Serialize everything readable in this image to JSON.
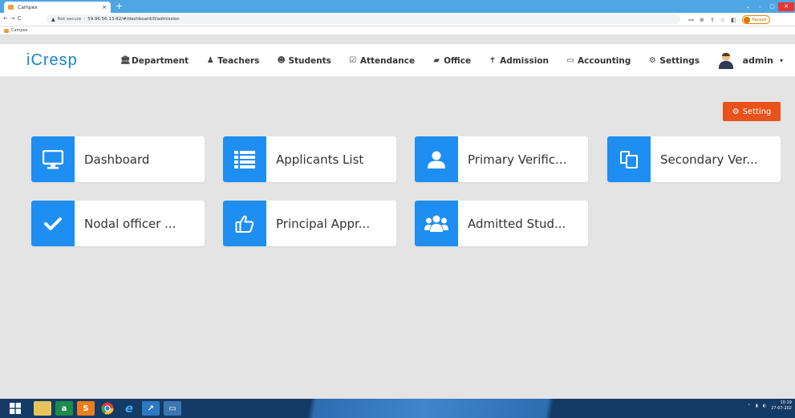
{
  "browser": {
    "tab_title": "Campex",
    "tab_close": "×",
    "new_tab": "+",
    "security": "Not secure",
    "url": "59.96.56.13:82/#/dashboard/0/admission",
    "bookmark": "Campex",
    "profile_status": "Paused",
    "window_controls": [
      "⌄",
      "–",
      "▢",
      "✕"
    ]
  },
  "app": {
    "logo": "iCresp",
    "nav": [
      {
        "label": "Department",
        "icon": "bank-icon"
      },
      {
        "label": "Teachers",
        "icon": "user-icon"
      },
      {
        "label": "Students",
        "icon": "users-icon"
      },
      {
        "label": "Attendance",
        "icon": "check-square-icon"
      },
      {
        "label": "Office",
        "icon": "book-icon"
      },
      {
        "label": "Admission",
        "icon": "graduate-icon"
      },
      {
        "label": "Accounting",
        "icon": "credit-card-icon"
      },
      {
        "label": "Settings",
        "icon": "gear-icon"
      }
    ],
    "user": "admin"
  },
  "content": {
    "setting_button": "Setting",
    "cards": [
      {
        "label": "Dashboard",
        "icon": "monitor-icon"
      },
      {
        "label": "Applicants List",
        "icon": "list-icon"
      },
      {
        "label": "Primary Verific...",
        "icon": "user-icon"
      },
      {
        "label": "Secondary Ver...",
        "icon": "copy-icon"
      },
      {
        "label": "Nodal officer ...",
        "icon": "check-icon"
      },
      {
        "label": "Principal Appr...",
        "icon": "thumbs-up-icon"
      },
      {
        "label": "Admitted Stud...",
        "icon": "users-icon"
      }
    ]
  },
  "taskbar": {
    "clock_time": "10:19",
    "clock_date": "27-07-202"
  },
  "colors": {
    "primary": "#1f8ef2",
    "accent": "#e8521d",
    "logo": "#1583d2",
    "taskbar": "#143a66"
  }
}
